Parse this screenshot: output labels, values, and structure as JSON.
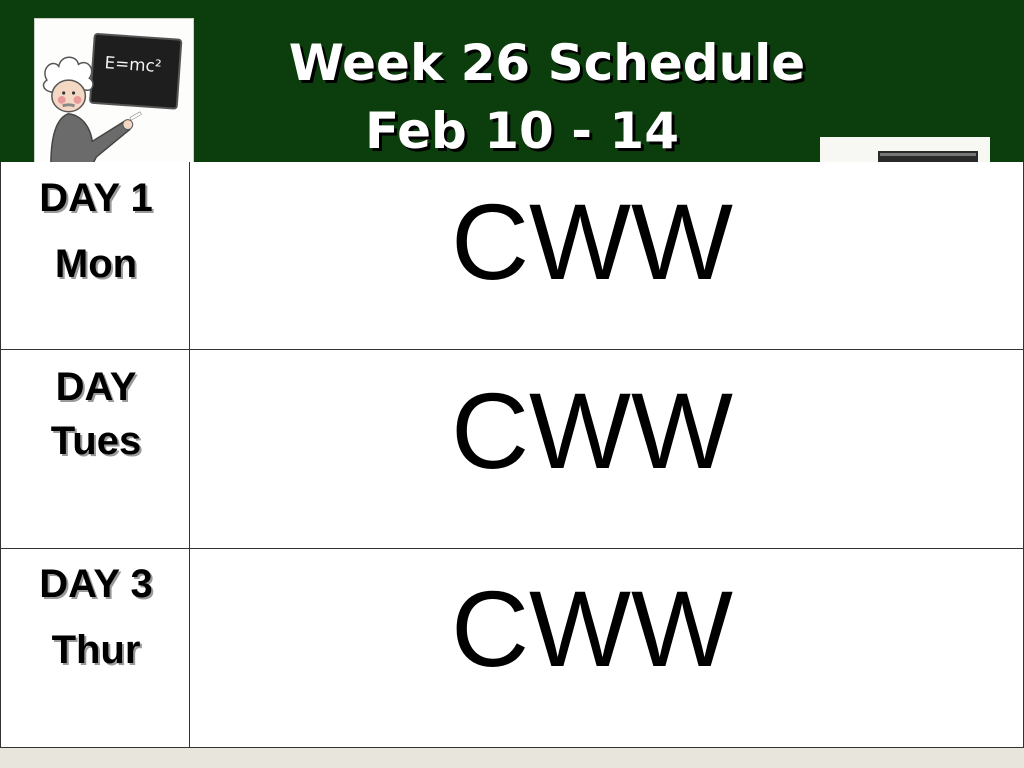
{
  "header": {
    "title": "Week 26 Schedule",
    "subtitle": "Feb 10 - 14",
    "logo_icon": "einstein-chalkboard-icon",
    "logo_text": "E=mc²",
    "background_color": "#0c3d0c"
  },
  "schedule": {
    "rows": [
      {
        "day": "DAY 1",
        "weekday": "Mon",
        "content": "CWW"
      },
      {
        "day": "DAY",
        "weekday": "Tues",
        "content": "CWW"
      },
      {
        "day": "DAY 3",
        "weekday": "Thur",
        "content": "CWW"
      }
    ]
  }
}
